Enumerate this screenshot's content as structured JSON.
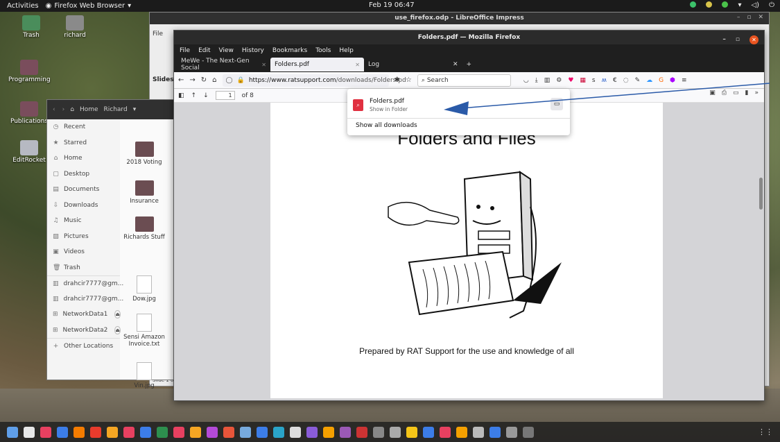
{
  "topbar": {
    "activities": "Activities",
    "app_menu": "Firefox Web Browser",
    "clock": "Feb 19  06:47"
  },
  "desktop_icons": [
    "Trash",
    "richard",
    "Programming",
    "Publications",
    "EditRocket"
  ],
  "impress": {
    "title": "use_firefox.odp - LibreOffice Impress",
    "menu_file": "File",
    "slides_label": "Slides",
    "status": "Slide 1 of"
  },
  "files": {
    "path_home": "Home",
    "path_user": "Richard",
    "sidebar": [
      {
        "label": "Recent",
        "icon": "clock-icon",
        "glyph": "◷"
      },
      {
        "label": "Starred",
        "icon": "star-icon",
        "glyph": "★"
      },
      {
        "label": "Home",
        "icon": "home-icon",
        "glyph": "⌂"
      },
      {
        "label": "Desktop",
        "icon": "desktop-icon",
        "glyph": "▢"
      },
      {
        "label": "Documents",
        "icon": "document-icon",
        "glyph": "▤"
      },
      {
        "label": "Downloads",
        "icon": "download-icon",
        "glyph": "⇩"
      },
      {
        "label": "Music",
        "icon": "music-icon",
        "glyph": "♫"
      },
      {
        "label": "Pictures",
        "icon": "picture-icon",
        "glyph": "▨"
      },
      {
        "label": "Videos",
        "icon": "video-icon",
        "glyph": "▣"
      },
      {
        "label": "Trash",
        "icon": "trash-icon",
        "glyph": "🗑"
      },
      {
        "label": "drahcir7777@gm...",
        "icon": "drive-icon",
        "glyph": "▥"
      },
      {
        "label": "drahcir7777@gm...",
        "icon": "drive-icon",
        "glyph": "▥"
      },
      {
        "label": "NetworkData1",
        "icon": "network-drive-icon",
        "glyph": "⊞",
        "eject": true
      },
      {
        "label": "NetworkData2",
        "icon": "network-drive-icon",
        "glyph": "⊞",
        "eject": true
      },
      {
        "label": "Other Locations",
        "icon": "plus-icon",
        "glyph": "+"
      }
    ],
    "grid": [
      {
        "label": "2018 Voting",
        "kind": "folder"
      },
      {
        "label": "Insurance",
        "kind": "folder"
      },
      {
        "label": "Richards Stuff",
        "kind": "folder"
      },
      {
        "label": "Dow.jpg",
        "kind": "file"
      },
      {
        "label": "Sensi Amazon Invoice.txt",
        "kind": "file"
      },
      {
        "label": "Vin.jpg",
        "kind": "file"
      }
    ]
  },
  "firefox": {
    "title": "Folders.pdf — Mozilla Firefox",
    "menu": [
      "File",
      "Edit",
      "View",
      "History",
      "Bookmarks",
      "Tools",
      "Help"
    ],
    "tabs": [
      {
        "label": "MeWe - The Next-Gen Social",
        "active": false
      },
      {
        "label": "Folders.pdf",
        "active": true
      },
      {
        "label": "Log",
        "active": false
      }
    ],
    "url_domain": "https://www.ratsupport.com",
    "url_path": "/downloads/Folders.pd",
    "search_placeholder": "Search",
    "page_number": "1",
    "page_count": "of 8",
    "pdf_heading": "Folders and Files",
    "pdf_caption": "Prepared by RAT Support for the use and knowledge of all"
  },
  "downloads": {
    "file_name": "Folders.pdf",
    "file_status": "Show in Folder",
    "show_all": "Show all downloads"
  }
}
